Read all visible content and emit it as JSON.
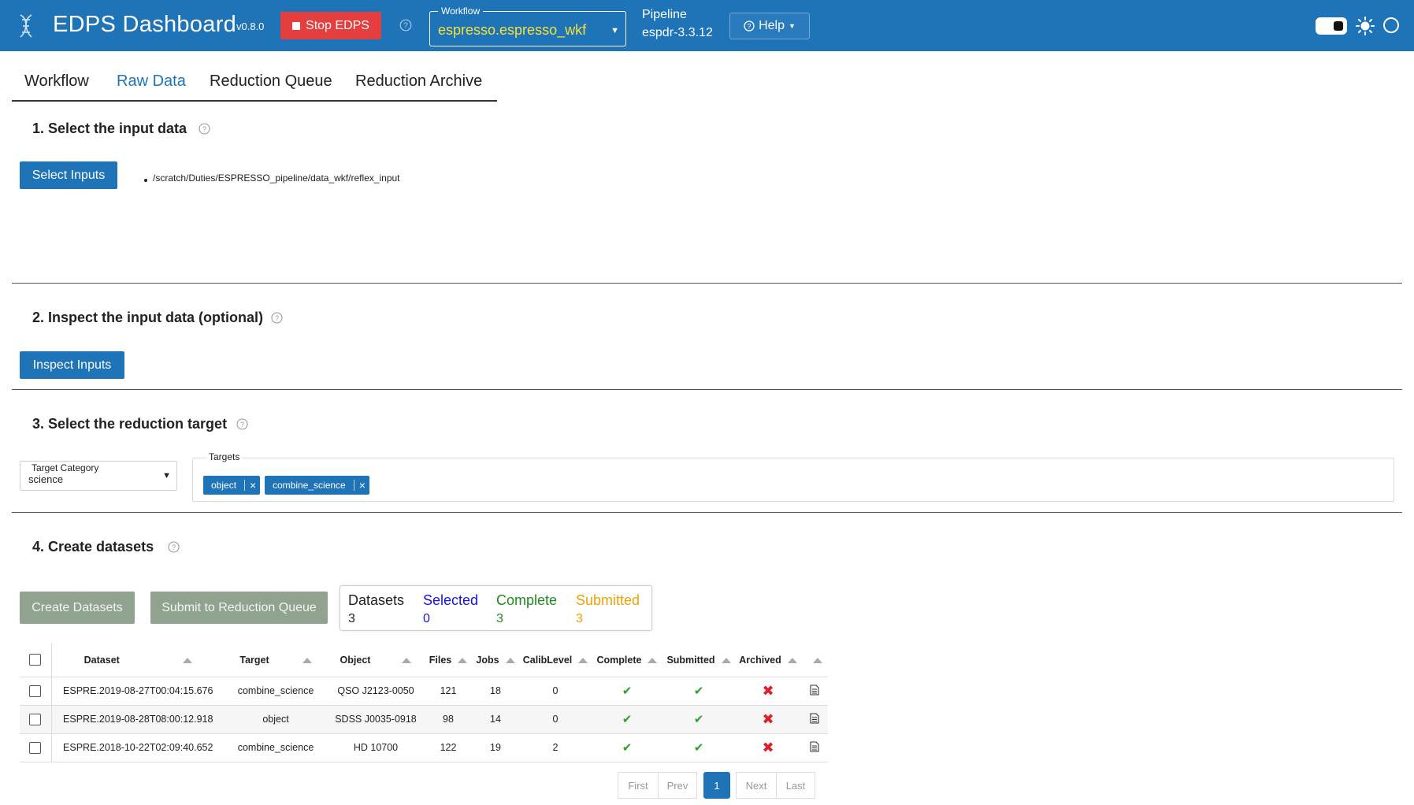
{
  "header": {
    "app_title": "EDPS Dashboard",
    "version": "v0.8.0",
    "stop_label": "Stop EDPS",
    "workflow_label": "Workflow",
    "workflow_value": "espresso.espresso_wkf",
    "pipeline_label": "Pipeline",
    "pipeline_value": "espdr-3.3.12",
    "help_label": "Help",
    "colors": {
      "bar": "#1f73b7",
      "stop": "#e53e3e",
      "workflow_value": "#f6e13a"
    }
  },
  "tabs": [
    {
      "label": "Workflow",
      "active": false
    },
    {
      "label": "Raw Data",
      "active": true
    },
    {
      "label": "Reduction Queue",
      "active": false
    },
    {
      "label": "Reduction Archive",
      "active": false
    }
  ],
  "section1": {
    "title": "1. Select the input data",
    "button": "Select Inputs",
    "inputs": [
      "/scratch/Duties/ESPRESSO_pipeline/data_wkf/reflex_input"
    ]
  },
  "section2": {
    "title": "2. Inspect the input data (optional)",
    "button": "Inspect Inputs"
  },
  "section3": {
    "title": "3. Select the reduction target",
    "category_label": "Target Category",
    "category_value": "science",
    "targets_label": "Targets",
    "targets": [
      "object",
      "combine_science"
    ]
  },
  "section4": {
    "title": "4. Create datasets",
    "create_button": "Create Datasets",
    "submit_button": "Submit to Reduction Queue",
    "stats": [
      {
        "label": "Datasets",
        "value": "3",
        "color": "#222222"
      },
      {
        "label": "Selected",
        "value": "0",
        "color": "#1515d0"
      },
      {
        "label": "Complete",
        "value": "3",
        "color": "#1f8a1f"
      },
      {
        "label": "Submitted",
        "value": "3",
        "color": "#f0a000"
      }
    ]
  },
  "table": {
    "headers": [
      "Dataset",
      "Target",
      "Object",
      "Files",
      "Jobs",
      "CalibLevel",
      "Complete",
      "Submitted",
      "Archived"
    ],
    "rows": [
      {
        "dataset": "ESPRE.2019-08-27T00:04:15.676",
        "target": "combine_science",
        "object": "QSO J2123-0050",
        "files": "121",
        "jobs": "18",
        "calib": "0",
        "complete": true,
        "submitted": true,
        "archived": false
      },
      {
        "dataset": "ESPRE.2019-08-28T08:00:12.918",
        "target": "object",
        "object": "SDSS J0035-0918",
        "files": "98",
        "jobs": "14",
        "calib": "0",
        "complete": true,
        "submitted": true,
        "archived": false
      },
      {
        "dataset": "ESPRE.2018-10-22T02:09:40.652",
        "target": "combine_science",
        "object": "HD 10700",
        "files": "122",
        "jobs": "19",
        "calib": "2",
        "complete": true,
        "submitted": true,
        "archived": false
      }
    ]
  },
  "pagination": {
    "first": "First",
    "prev": "Prev",
    "current": "1",
    "next": "Next",
    "last": "Last"
  },
  "icons": {
    "logo": "dna-logo-icon",
    "stop": "stop-square-icon",
    "help": "question-circle-icon",
    "theme_dark": "toggle-icon",
    "theme_light": "sun-icon",
    "theme_auto": "circle-icon",
    "check": "check-icon",
    "cross": "cross-icon",
    "details": "document-icon"
  }
}
